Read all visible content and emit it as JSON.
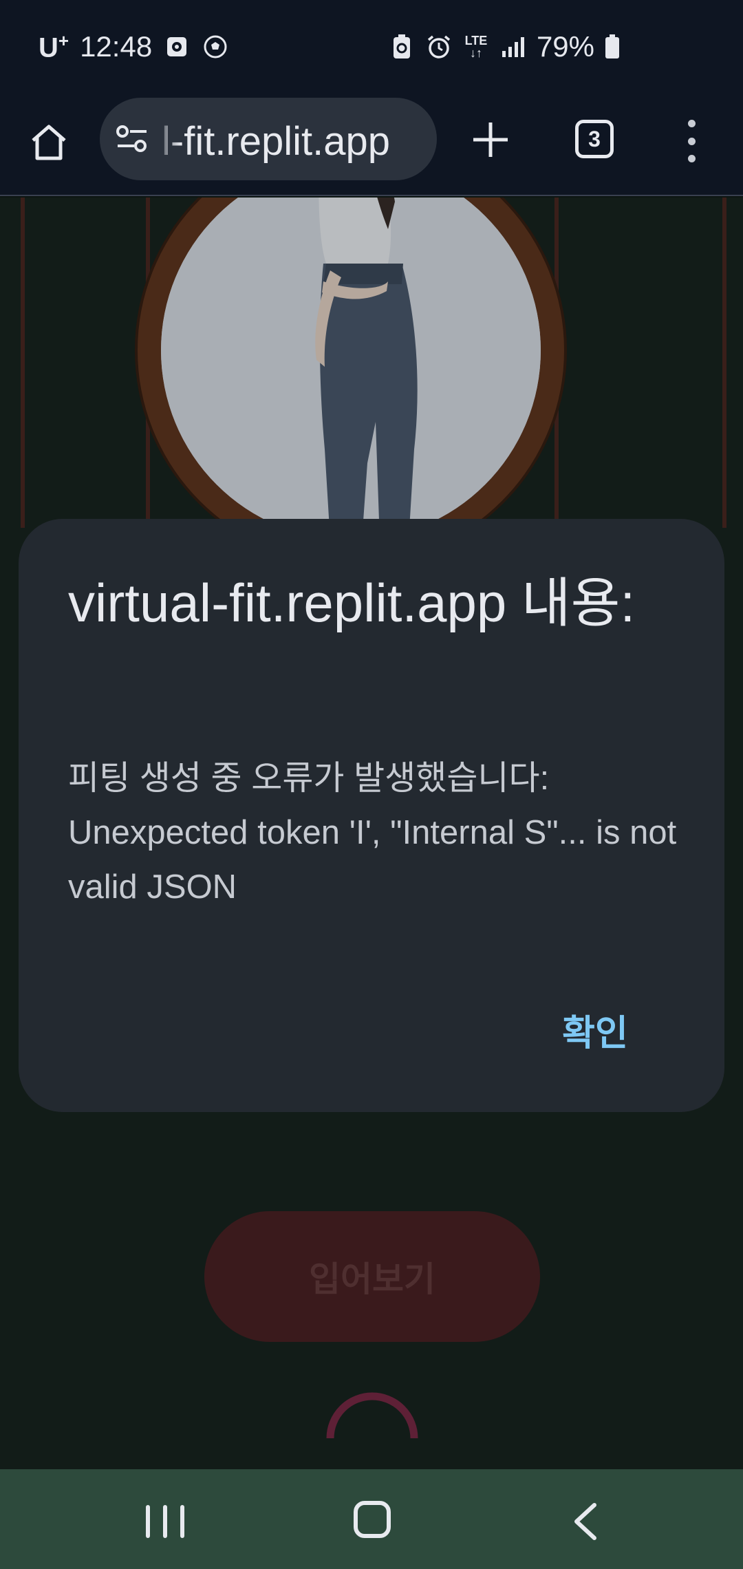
{
  "status_bar": {
    "carrier": "U",
    "carrier_sup": "+",
    "time": "12:48",
    "network": "LTE",
    "battery": "79%",
    "icons": [
      "screenshot-icon",
      "soccer-ball-icon",
      "battery-saver-icon",
      "alarm-icon",
      "lte-data-icon",
      "signal-icon",
      "battery-icon"
    ]
  },
  "browser": {
    "url": "l-fit.replit.app",
    "tab_count": "3",
    "icons": [
      "home-icon",
      "site-settings-icon",
      "new-tab-icon",
      "tab-switcher-icon",
      "more-menu-icon"
    ]
  },
  "page": {
    "try_button_label": "입어보기"
  },
  "dialog": {
    "title": "virtual-fit.replit.app 내용:",
    "message": "피팅 생성 중 오류가 발생했습니다: Unexpected token 'I', \"Internal S\"... is not valid JSON",
    "ok_label": "확인"
  },
  "nav_bar": {
    "icons": [
      "recents-icon",
      "home-nav-icon",
      "back-icon"
    ]
  },
  "colors": {
    "dialog_bg": "#232930",
    "accent": "#7ec8f4",
    "nav_bar": "#2d4a3c",
    "toolbar": "#0e1522"
  }
}
